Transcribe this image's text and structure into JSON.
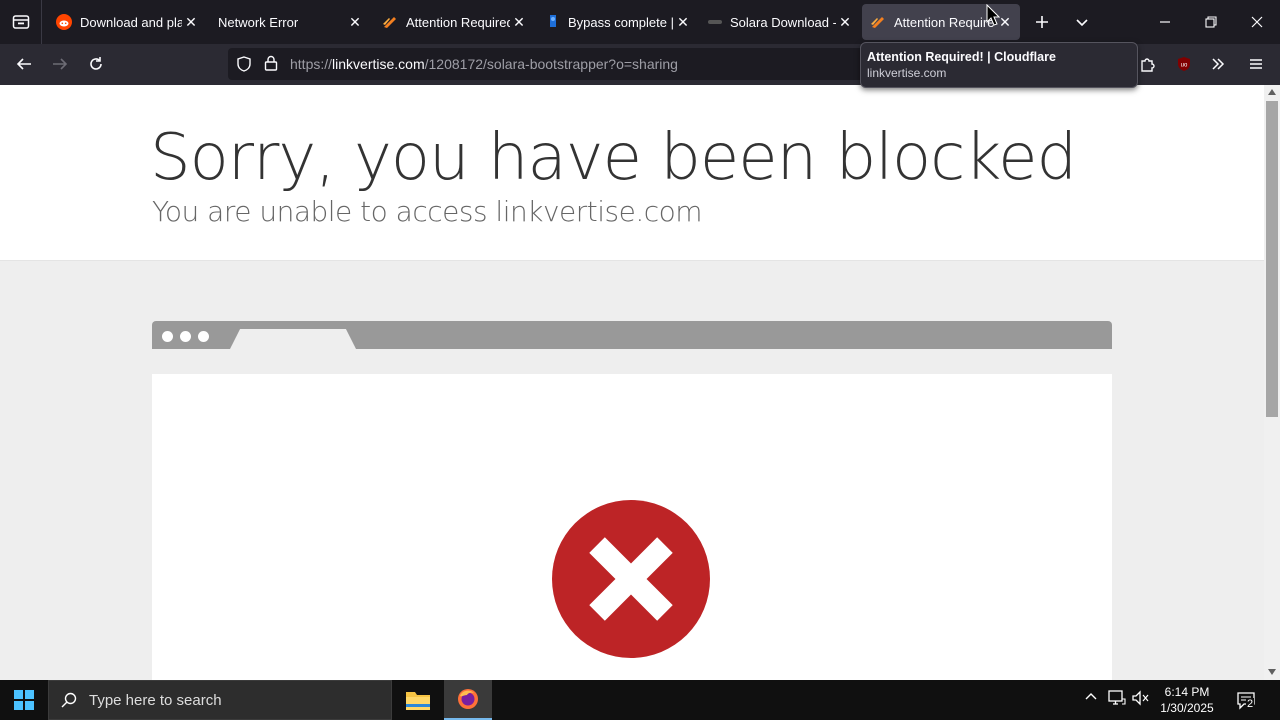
{
  "browser": {
    "tabs": [
      {
        "title": "Download and play",
        "favicon": "reddit-icon"
      },
      {
        "title": "Network Error",
        "favicon": "none"
      },
      {
        "title": "Attention Required!",
        "favicon": "cloudflare-icon"
      },
      {
        "title": "Bypass complete | B",
        "favicon": "bypass-icon"
      },
      {
        "title": "Solara Download - V",
        "favicon": "solara-icon"
      },
      {
        "title": "Attention Require",
        "favicon": "cloudflare-icon",
        "active": true
      }
    ],
    "url_prefix": "https://",
    "url_host": "linkvertise.com",
    "url_path": "/1208172/solara-bootstrapper?o=sharing",
    "tooltip": {
      "title": "Attention Required! | Cloudflare",
      "url": "linkvertise.com"
    }
  },
  "page": {
    "heading": "Sorry, you have been blocked",
    "subheading": "You are unable to access linkvertise.com"
  },
  "taskbar": {
    "search_placeholder": "Type here to search",
    "time": "6:14 PM",
    "date": "1/30/2025",
    "notification_count": "2"
  },
  "colors": {
    "error_red": "#bd2426",
    "tab_active": "#42414d",
    "taskbar_accent": "#76b9ed"
  }
}
